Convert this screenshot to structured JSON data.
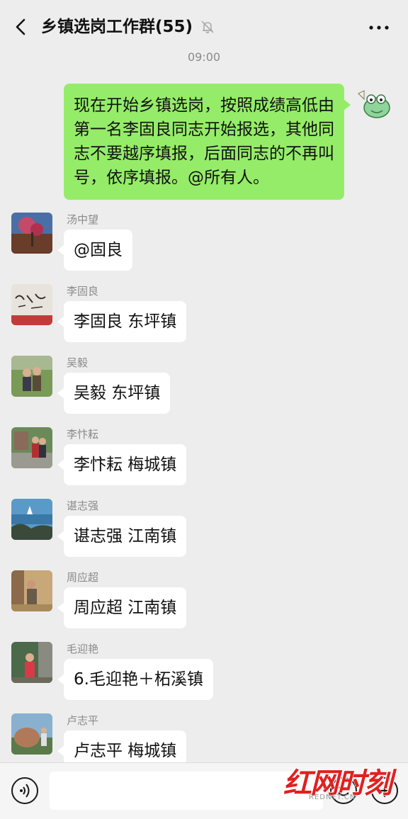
{
  "header": {
    "title": "乡镇选岗工作群(55)",
    "back_icon": "chevron-left-icon",
    "mute_icon": "bell-off-icon",
    "more_icon": "more-icon"
  },
  "timestamp": "09:00",
  "own_message": {
    "text": "现在开始乡镇选岗，按照成绩高低由第一名李固良同志开始报选，其他同志不要越序填报，后面同志的不再叫号，依序填报。@所有人。",
    "bubble_color": "#95ec69"
  },
  "messages": [
    {
      "sender": "汤中望",
      "text": "@固良"
    },
    {
      "sender": "李固良",
      "text": "李固良 东坪镇"
    },
    {
      "sender": "吴毅",
      "text": "吴毅 东坪镇"
    },
    {
      "sender": "李忭耘",
      "text": "李忭耘  梅城镇"
    },
    {
      "sender": "谌志强",
      "text": "谌志强 江南镇"
    },
    {
      "sender": "周应超",
      "text": "周应超  江南镇"
    },
    {
      "sender": "毛迎艳",
      "text": "6.毛迎艳＋柘溪镇"
    },
    {
      "sender": "卢志平",
      "text": "卢志平  梅城镇"
    }
  ],
  "input_bar": {
    "voice_icon": "voice-icon",
    "emoji_icon": "emoji-icon",
    "plus_icon": "plus-icon"
  },
  "watermark": {
    "text": "红网时刻",
    "sub": "REDNET.CN",
    "color": "#e02020"
  },
  "colors": {
    "background": "#ededed",
    "incoming_bubble": "#ffffff"
  }
}
